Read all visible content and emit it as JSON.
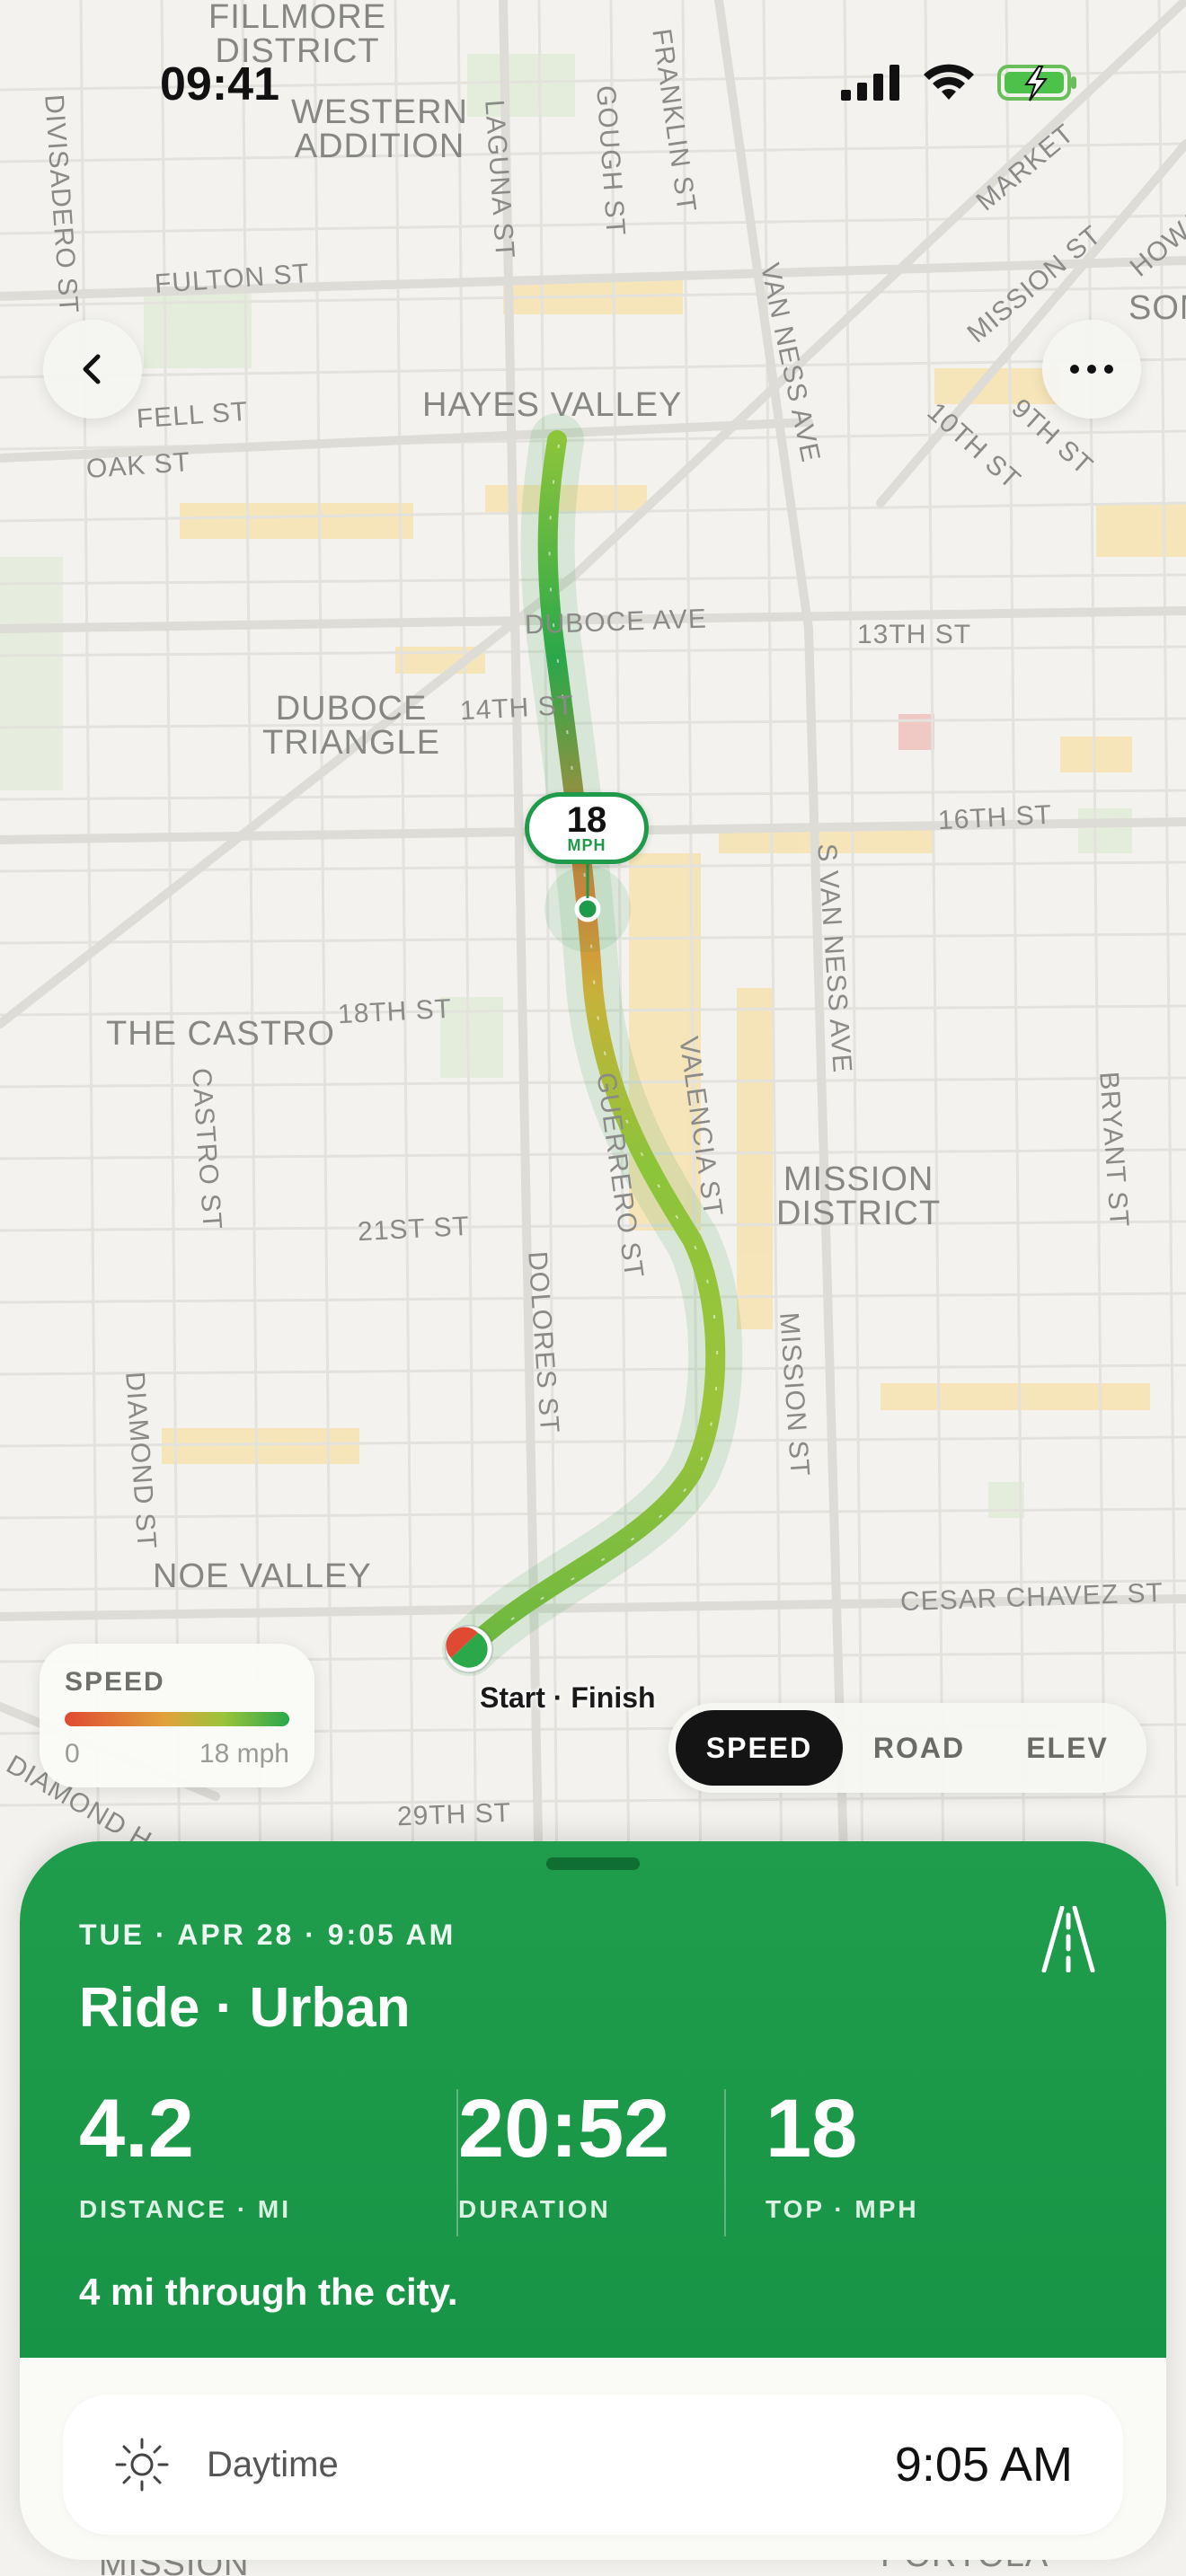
{
  "status_bar": {
    "time": "09:41"
  },
  "map": {
    "districts": [
      {
        "id": "fillmore",
        "text": "FILLMORE\nDISTRICT"
      },
      {
        "id": "western-addition",
        "text": "WESTERN\nADDITION"
      },
      {
        "id": "hayes-valley",
        "text": "HAYES VALLEY"
      },
      {
        "id": "duboce-triangle",
        "text": "DUBOCE\nTRIANGLE"
      },
      {
        "id": "the-castro",
        "text": "THE CASTRO"
      },
      {
        "id": "mission-district",
        "text": "MISSION\nDISTRICT"
      },
      {
        "id": "noe-valley",
        "text": "NOE VALLEY"
      },
      {
        "id": "som",
        "text": "SOM"
      },
      {
        "id": "mission-bottom",
        "text": "MISSION"
      },
      {
        "id": "portola",
        "text": "PORTOLA"
      }
    ],
    "streets": [
      {
        "id": "divisadero",
        "text": "DIVISADERO ST"
      },
      {
        "id": "laguna",
        "text": "LAGUNA ST"
      },
      {
        "id": "gough",
        "text": "GOUGH ST"
      },
      {
        "id": "franklin",
        "text": "FRANKLIN ST"
      },
      {
        "id": "fulton",
        "text": "FULTON ST"
      },
      {
        "id": "fell",
        "text": "FELL ST"
      },
      {
        "id": "oak",
        "text": "OAK ST"
      },
      {
        "id": "van-ness",
        "text": "VAN NESS AVE"
      },
      {
        "id": "market",
        "text": "MARKET"
      },
      {
        "id": "mission-st-top",
        "text": "MISSION ST"
      },
      {
        "id": "howard",
        "text": "HOWARD"
      },
      {
        "id": "10th",
        "text": "10TH ST"
      },
      {
        "id": "9th",
        "text": "9TH ST"
      },
      {
        "id": "duboce-ave",
        "text": "DUBOCE AVE"
      },
      {
        "id": "13th",
        "text": "13TH ST"
      },
      {
        "id": "14th",
        "text": "14TH ST"
      },
      {
        "id": "16th",
        "text": "16TH ST"
      },
      {
        "id": "s-van-ness",
        "text": "S VAN NESS AVE"
      },
      {
        "id": "18th",
        "text": "18TH ST"
      },
      {
        "id": "castro",
        "text": "CASTRO ST"
      },
      {
        "id": "guerrero",
        "text": "GUERRERO ST"
      },
      {
        "id": "valencia",
        "text": "VALENCIA ST"
      },
      {
        "id": "bryant",
        "text": "BRYANT ST"
      },
      {
        "id": "21st",
        "text": "21ST ST"
      },
      {
        "id": "dolores",
        "text": "DOLORES ST"
      },
      {
        "id": "mission-st",
        "text": "MISSION ST"
      },
      {
        "id": "diamond",
        "text": "DIAMOND ST"
      },
      {
        "id": "cesar-chavez",
        "text": "CESAR CHAVEZ ST"
      },
      {
        "id": "diamond-h",
        "text": "DIAMOND H"
      },
      {
        "id": "29th",
        "text": "29TH ST"
      }
    ],
    "speed_tag": {
      "value": "18",
      "unit": "MPH"
    },
    "start_finish_label": "Start · Finish"
  },
  "legend": {
    "title": "SPEED",
    "min": "0",
    "max": "18 mph"
  },
  "view_modes": {
    "items": [
      {
        "label": "SPEED",
        "active": true
      },
      {
        "label": "ROAD",
        "active": false
      },
      {
        "label": "ELEV",
        "active": false
      }
    ]
  },
  "ride": {
    "date": "TUE · APR 28 · 9:05 AM",
    "title": "Ride · Urban",
    "stats": [
      {
        "value": "4.2",
        "label": "DISTANCE · MI"
      },
      {
        "value": "20:52",
        "label": "DURATION"
      },
      {
        "value": "18",
        "label": "TOP · MPH"
      }
    ],
    "caption": "4 mi through the city.",
    "time_of_day": {
      "label": "Daytime",
      "time": "9:05 AM"
    }
  },
  "colors": {
    "sheet_green": "#1f9d4c",
    "route_green": "#2aa84a",
    "route_yellow": "#9cc43b",
    "route_red": "#e04a33",
    "map_bg": "#f2f1ec"
  }
}
